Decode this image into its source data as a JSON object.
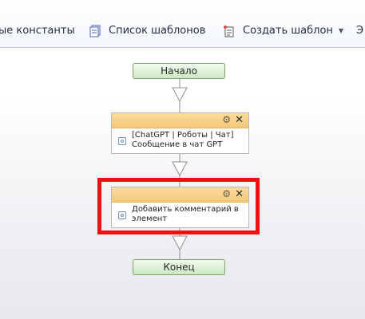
{
  "toolbar": {
    "items": [
      {
        "label": "ые константы",
        "icon": ""
      },
      {
        "label": "Список шаблонов",
        "icon": "template-list-icon"
      },
      {
        "label": "Создать шаблон",
        "icon": "create-template-icon",
        "dropdown": true
      },
      {
        "label": "Э",
        "icon": ""
      }
    ]
  },
  "workflow": {
    "start": "Начало",
    "end": "Конец",
    "activities": [
      {
        "text": "[ChatGPT | Роботы | Чат] Сообщение в чат GPT",
        "highlighted": false
      },
      {
        "text": "Добавить комментарий в элемент",
        "highlighted": true
      }
    ]
  },
  "colors": {
    "highlight": "#ee1111",
    "activity_header": "#f6cc82",
    "terminal": "#d6ecce"
  }
}
